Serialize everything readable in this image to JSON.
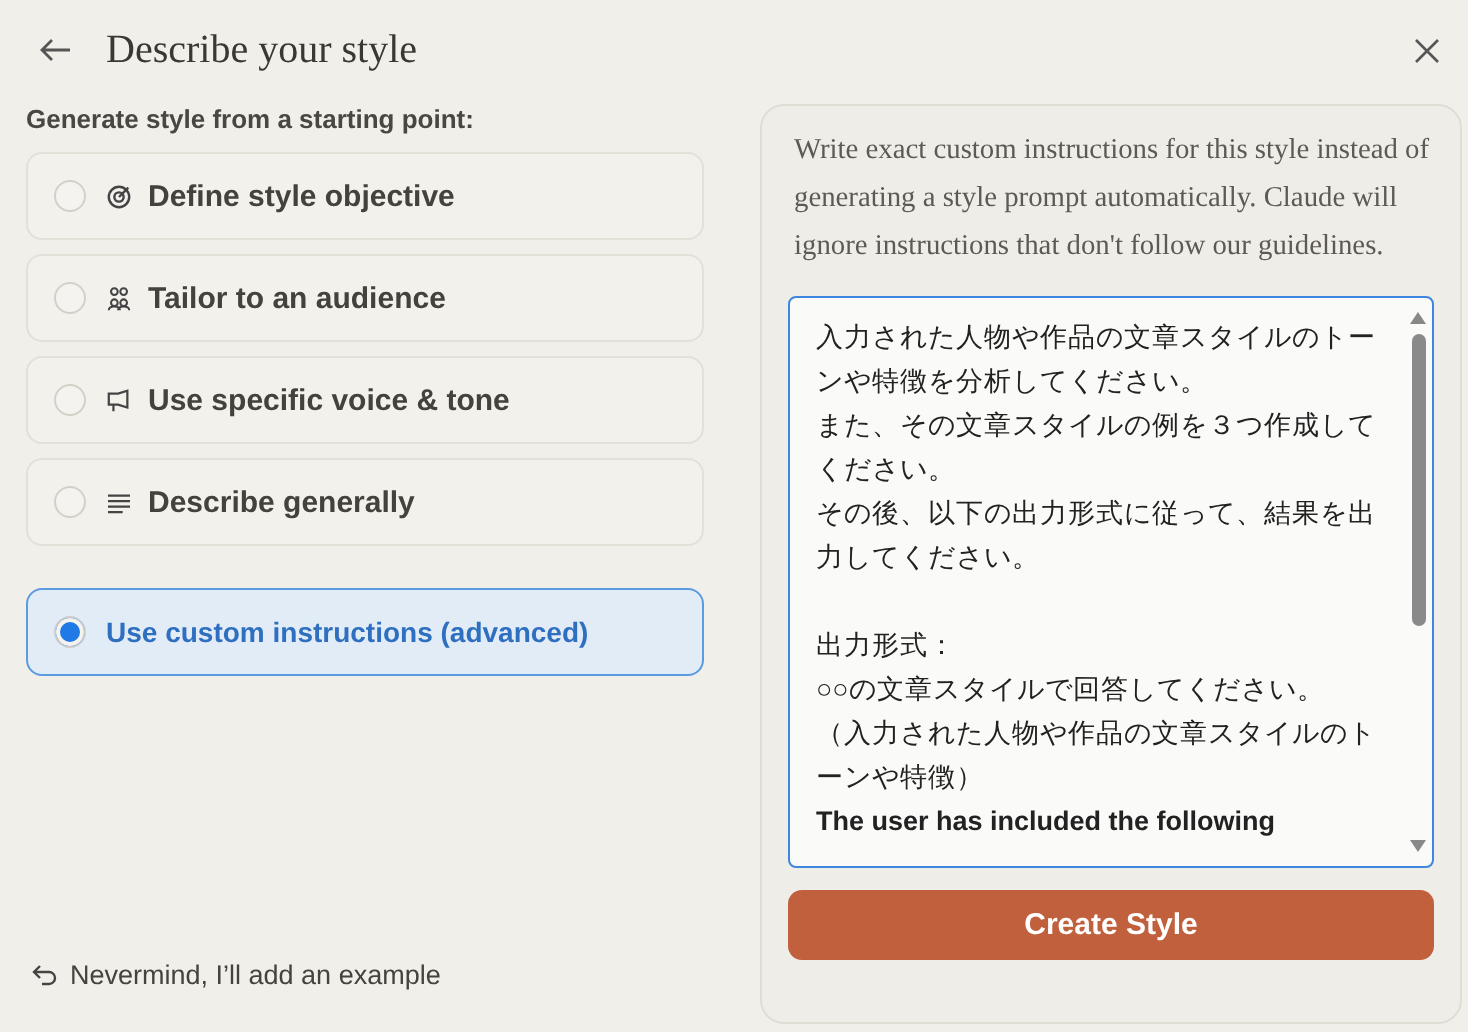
{
  "header": {
    "title": "Describe your style"
  },
  "section_label": "Generate style from a starting point:",
  "options": [
    {
      "kind": "objective",
      "label": "Define style objective",
      "selected": false
    },
    {
      "kind": "audience",
      "label": "Tailor to an audience",
      "selected": false
    },
    {
      "kind": "voice",
      "label": "Use specific voice & tone",
      "selected": false
    },
    {
      "kind": "general",
      "label": "Describe generally",
      "selected": false
    },
    {
      "kind": "custom",
      "label": "Use custom instructions (advanced)",
      "selected": true
    }
  ],
  "back_link": "Nevermind, I’ll add an example",
  "panel": {
    "description": "Write exact custom instructions for this style instead of generating a style prompt automatically. Claude will ignore instructions that don't follow our guidelines.",
    "instructions": [
      [
        "入力された人物や作品の文章スタイルのトーンや特徴を分析してください。",
        "また、その文章スタイルの例を３つ作成してください。",
        "その後、以下の出力形式に従って、結果を出力してください。"
      ],
      [
        "出力形式：",
        "○○の文章スタイルで回答してください。",
        "（入力された人物や作品の文章スタイルのトーンや特徴）",
        "**The user has included the following**"
      ]
    ],
    "submit": "Create Style"
  }
}
